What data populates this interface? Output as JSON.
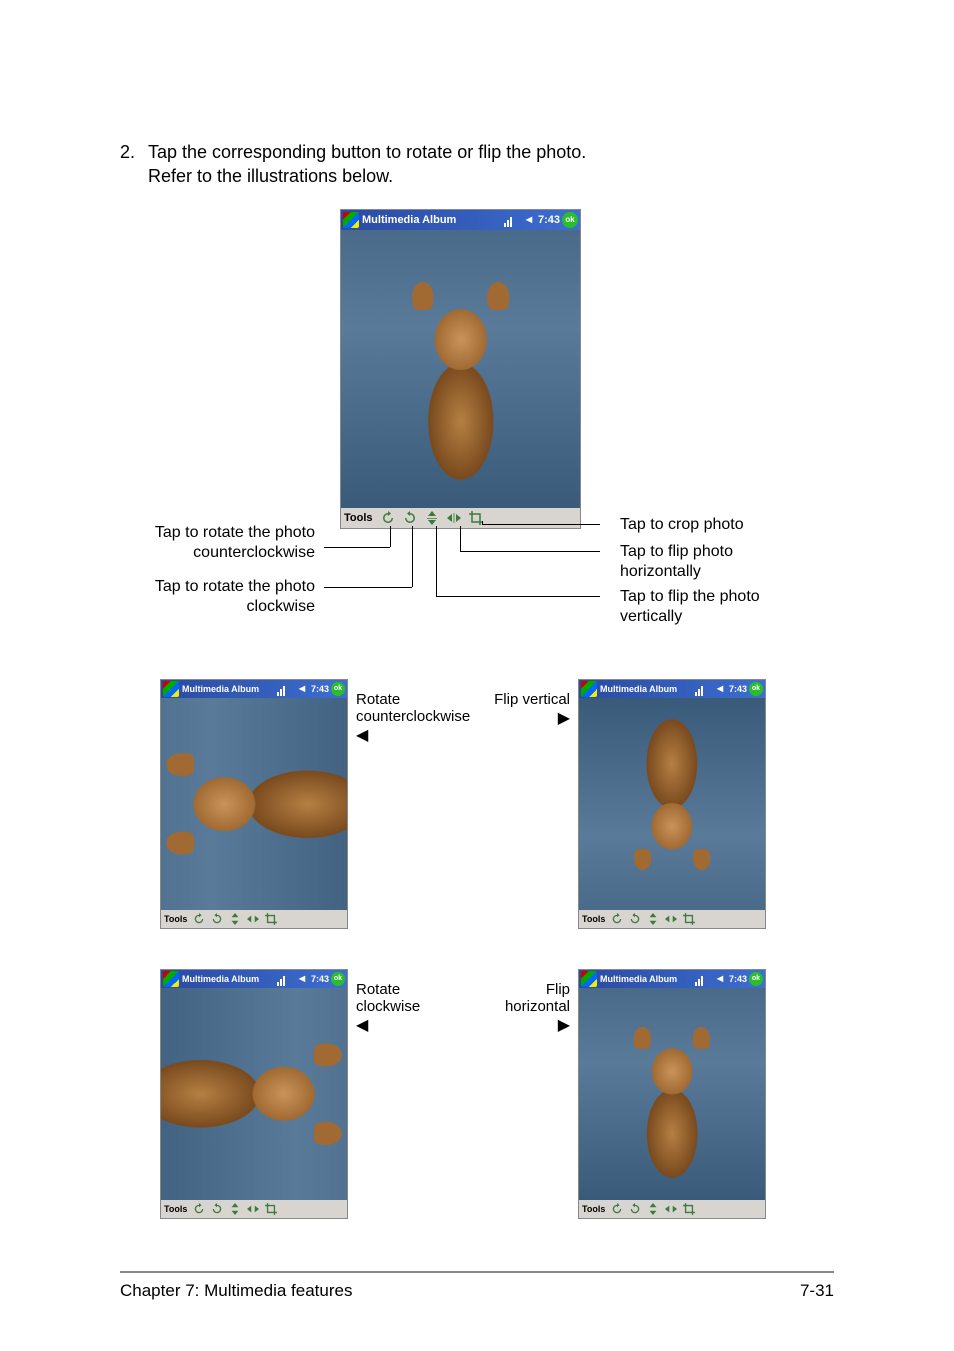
{
  "step": {
    "number": "2.",
    "text_line1": "Tap the corresponding button to rotate or flip the photo.",
    "text_line2": "Refer to the illustrations below."
  },
  "screen": {
    "title": "Multimedia Album",
    "time": "7:43",
    "ok": "ok",
    "tools_label": "Tools"
  },
  "labels": {
    "rotate_ccw_l1": "Tap to rotate the photo",
    "rotate_ccw_l2": "counterclockwise",
    "rotate_cw_l1": "Tap to rotate the photo",
    "rotate_cw_l2": "clockwise",
    "crop": "Tap to crop photo",
    "flip_h_l1": "Tap to flip photo",
    "flip_h_l2": "horizontally",
    "flip_v_l1": "Tap to flip the photo",
    "flip_v_l2": "vertically"
  },
  "quads": {
    "ccw_l1": "Rotate",
    "ccw_l2": "counterclockwise",
    "cw_l1": "Rotate",
    "cw_l2": "clockwise",
    "fv": "Flip vertical",
    "fh_l1": "Flip",
    "fh_l2": "horizontal",
    "arrow_left": "◀",
    "arrow_right": "▶"
  },
  "footer": {
    "chapter": "Chapter 7: Multimedia features",
    "page": "7-31"
  }
}
